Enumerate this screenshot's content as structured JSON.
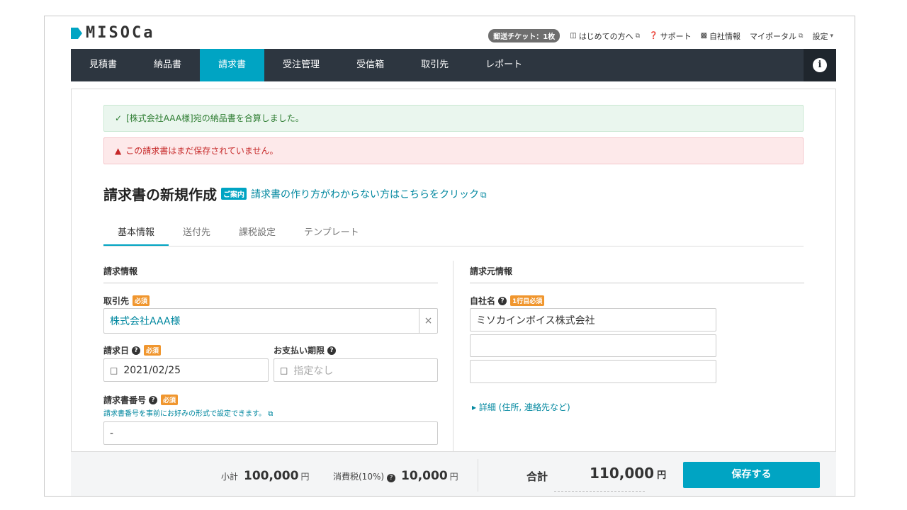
{
  "header": {
    "logo_text": "MISOCa",
    "ticket": "郵送チケット：1枚",
    "links": [
      {
        "label": "はじめての方へ",
        "icon": "book-icon"
      },
      {
        "label": "サポート",
        "icon": "help-circle-icon"
      },
      {
        "label": "自社情報",
        "icon": "building-icon"
      },
      {
        "label": "マイポータル",
        "icon": "external-link-icon"
      },
      {
        "label": "設定",
        "icon": "caret-down-icon"
      }
    ]
  },
  "nav": {
    "items": [
      "見積書",
      "納品書",
      "請求書",
      "受注管理",
      "受信箱",
      "取引先",
      "レポート"
    ],
    "active": "請求書"
  },
  "alerts": {
    "success": "[株式会社AAA様]宛の納品書を合算しました。",
    "error": "この請求書はまだ保存されていません。"
  },
  "page": {
    "title": "請求書の新規作成",
    "guide_badge": "ご案内",
    "guide_link": "請求書の作り方がわからない方はこちらをクリック"
  },
  "tabs": [
    "基本情報",
    "送付先",
    "課税設定",
    "テンプレート"
  ],
  "billing": {
    "section_title": "請求情報",
    "client_label": "取引先",
    "required": "必須",
    "client_value": "株式会社AAA様",
    "date_label": "請求日",
    "date_value": "2021/02/25",
    "due_label": "お支払い期限",
    "due_placeholder": "指定なし",
    "number_label": "請求書番号",
    "number_hint": "請求書番号を事前にお好みの形式で設定できます。",
    "number_value": "-"
  },
  "issuer": {
    "section_title": "請求元情報",
    "company_label": "自社名",
    "required": "1行目必須",
    "company_line1": "ミソカインボイス株式会社",
    "company_line2": "",
    "company_line3": "",
    "detail_link": "詳細 (住所, 連絡先など)"
  },
  "footer": {
    "subtotal_label": "小計",
    "subtotal_value": "100,000",
    "tax_label": "消費税(10%)",
    "tax_value": "10,000",
    "unit": "円",
    "total_label": "合計",
    "total_value": "110,000",
    "save_button": "保存する"
  },
  "colors": {
    "accent": "#00a4c3",
    "nav_bg": "#2d3640",
    "required": "#f0962e"
  }
}
